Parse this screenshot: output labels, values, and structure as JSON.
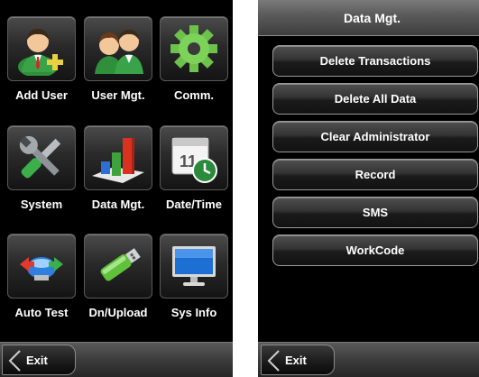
{
  "main_menu": {
    "tiles": [
      {
        "label": "Add User",
        "icon": "add-user-icon"
      },
      {
        "label": "User Mgt.",
        "icon": "users-icon"
      },
      {
        "label": "Comm.",
        "icon": "gear-icon"
      },
      {
        "label": "System",
        "icon": "wrench-screwdriver-icon"
      },
      {
        "label": "Data Mgt.",
        "icon": "bar-chart-icon"
      },
      {
        "label": "Date/Time",
        "icon": "calendar-clock-icon"
      },
      {
        "label": "Auto Test",
        "icon": "arrows-cycle-icon"
      },
      {
        "label": "Dn/Upload",
        "icon": "usb-drive-icon"
      },
      {
        "label": "Sys Info",
        "icon": "monitor-icon"
      }
    ],
    "exit_label": "Exit"
  },
  "data_mgt": {
    "title": "Data Mgt.",
    "buttons": [
      "Delete Transactions",
      "Delete All Data",
      "Clear Administrator",
      "Record",
      "SMS",
      "WorkCode"
    ],
    "exit_label": "Exit"
  },
  "colors": {
    "screen_background": "#000000",
    "label_text": "#ffffff",
    "gear_green": "#6cc24a",
    "chart_red": "#d9321f",
    "chart_blue": "#2d6fd6",
    "chart_green": "#3ea33a"
  }
}
